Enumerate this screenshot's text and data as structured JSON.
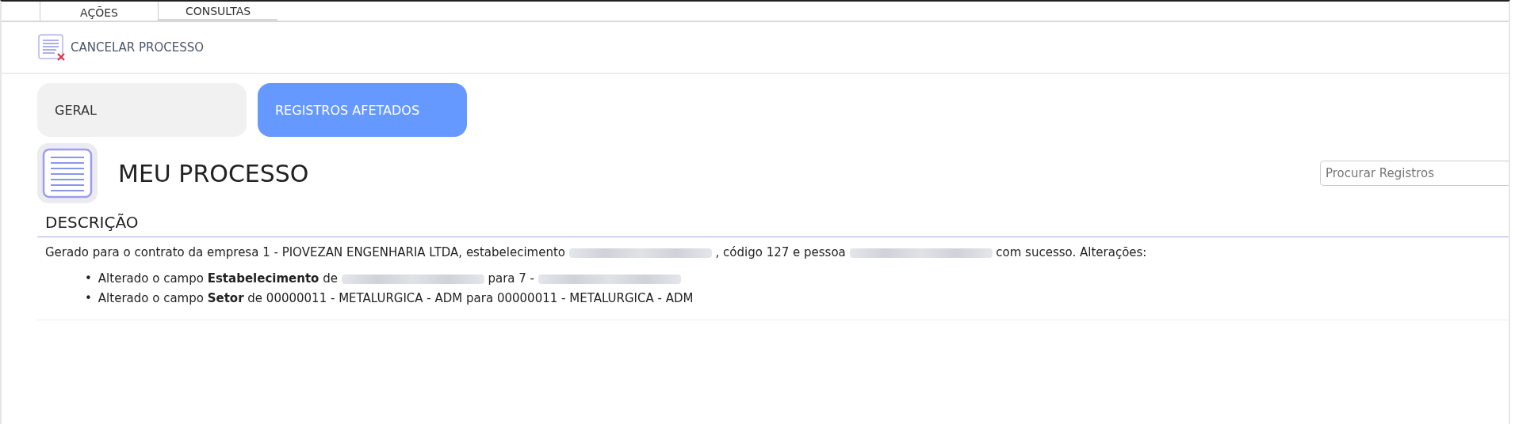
{
  "top_tabs": [
    {
      "label": "AÇÕES",
      "selected": true
    },
    {
      "label": "CONSULTAS",
      "selected": false
    }
  ],
  "toolbar": {
    "action": "CANCELAR PROCESSO"
  },
  "section_tabs": [
    {
      "label": "GERAL",
      "selected": false
    },
    {
      "label": "REGISTROS AFETADOS",
      "selected": true
    }
  ],
  "title": "MEU PROCESSO",
  "search": {
    "placeholder": "Procurar Registros"
  },
  "description": {
    "heading": "DESCRIÇÃO",
    "paragraph": [
      {
        "kind": "text",
        "text": "Gerado para o contrato da empresa 1 - PIOVEZAN ENGENHARIA LTDA, estabelecimento"
      },
      {
        "kind": "redacted"
      },
      {
        "kind": "text",
        "text": ", código 127 e pessoa"
      },
      {
        "kind": "redacted"
      },
      {
        "kind": "text",
        "text": "com sucesso. Alterações:"
      }
    ],
    "changes": [
      {
        "marker": "•",
        "parts": [
          {
            "kind": "text",
            "text": "Alterado o campo **Estabelecimento** de"
          },
          {
            "kind": "redacted"
          },
          {
            "kind": "text",
            "text": "para 7 -"
          },
          {
            "kind": "redacted"
          }
        ]
      },
      {
        "marker": "•",
        "parts": [
          {
            "kind": "text",
            "text": "Alterado o campo **Setor** de 00000011 - METALURGICA - ADM para 00000011 - METALURGICA - ADM"
          }
        ]
      }
    ]
  }
}
